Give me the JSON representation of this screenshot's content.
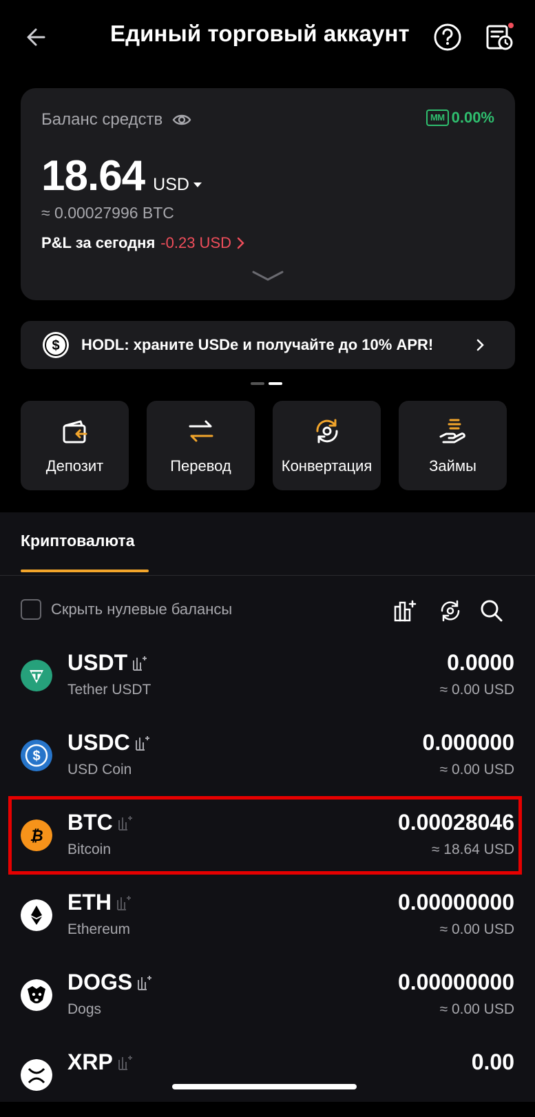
{
  "header": {
    "title": "Единый торговый аккаунт",
    "back_icon": "arrow-left-icon",
    "help_icon": "question-circle-icon",
    "history_icon": "document-clock-icon"
  },
  "balance_card": {
    "label": "Баланс средств",
    "mm_badge": "MM",
    "mm_value": "0.00%",
    "balance": "18.64",
    "currency": "USD",
    "btc_equivalent": "≈ 0.00027996 BTC",
    "pnl_label": "P&L за сегодня",
    "pnl_value": "-0.23 USD",
    "pnl_arrow": "›"
  },
  "promo": {
    "text": "HODL: храните USDe и получайте до 10% APR!",
    "icon": "dollar-coin-icon"
  },
  "actions": [
    {
      "label": "Депозит",
      "icon": "wallet-deposit-icon"
    },
    {
      "label": "Перевод",
      "icon": "transfer-arrows-icon"
    },
    {
      "label": "Конвертация",
      "icon": "convert-icon"
    },
    {
      "label": "Займы",
      "icon": "loan-hand-icon"
    }
  ],
  "tabs": {
    "crypto": "Криптовалюта"
  },
  "filter": {
    "hide_zero": "Скрыть нулевые балансы"
  },
  "assets": [
    {
      "symbol": "USDT",
      "name": "Tether USDT",
      "amount": "0.0000",
      "usd": "≈ 0.00 USD",
      "color": "#26a17b"
    },
    {
      "symbol": "USDC",
      "name": "USD Coin",
      "amount": "0.000000",
      "usd": "≈ 0.00 USD",
      "color": "#2775ca"
    },
    {
      "symbol": "BTC",
      "name": "Bitcoin",
      "amount": "0.00028046",
      "usd": "≈ 18.64 USD",
      "color": "#f7931a"
    },
    {
      "symbol": "ETH",
      "name": "Ethereum",
      "amount": "0.00000000",
      "usd": "≈ 0.00 USD",
      "color": "#ffffff"
    },
    {
      "symbol": "DOGS",
      "name": "Dogs",
      "amount": "0.00000000",
      "usd": "≈ 0.00 USD",
      "color": "#ffffff"
    },
    {
      "symbol": "XRP",
      "name": "",
      "amount": "0.00",
      "usd": "",
      "color": "#ffffff"
    }
  ],
  "colors": {
    "accent": "#f2a52b",
    "positive": "#2fbf6f",
    "negative": "#f04e5b",
    "highlight": "#e60000"
  }
}
